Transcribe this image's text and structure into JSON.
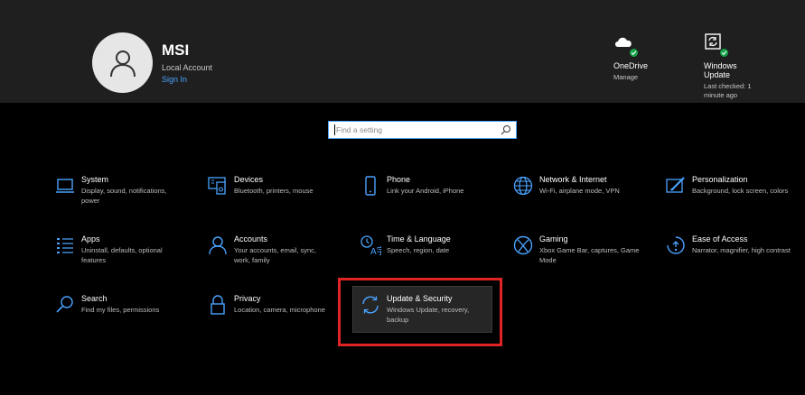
{
  "account": {
    "name": "MSI",
    "type": "Local Account",
    "signin": "Sign In"
  },
  "onedrive": {
    "title": "OneDrive",
    "sub": "Manage",
    "icon": "onedrive-cloud-icon"
  },
  "windows_update": {
    "title": "Windows Update",
    "sub": "Last checked: 1 minute ago",
    "icon": "refresh-icon"
  },
  "search": {
    "placeholder": "Find a setting",
    "icon": "search-icon"
  },
  "accent_color": "#4aa3ff",
  "tiles": [
    {
      "title": "System",
      "desc": "Display, sound, notifications, power",
      "icon": "laptop-icon"
    },
    {
      "title": "Devices",
      "desc": "Bluetooth, printers, mouse",
      "icon": "devices-icon"
    },
    {
      "title": "Phone",
      "desc": "Link your Android, iPhone",
      "icon": "phone-icon"
    },
    {
      "title": "Network & Internet",
      "desc": "Wi-Fi, airplane mode, VPN",
      "icon": "globe-icon"
    },
    {
      "title": "Personalization",
      "desc": "Background, lock screen, colors",
      "icon": "brush-icon"
    },
    {
      "title": "Apps",
      "desc": "Uninstall, defaults, optional features",
      "icon": "apps-list-icon"
    },
    {
      "title": "Accounts",
      "desc": "Your accounts, email, sync, work, family",
      "icon": "person-icon"
    },
    {
      "title": "Time & Language",
      "desc": "Speech, region, date",
      "icon": "time-language-icon"
    },
    {
      "title": "Gaming",
      "desc": "Xbox Game Bar, captures, Game Mode",
      "icon": "xbox-icon"
    },
    {
      "title": "Ease of Access",
      "desc": "Narrator, magnifier, high contrast",
      "icon": "ease-of-access-icon"
    },
    {
      "title": "Search",
      "desc": "Find my files, permissions",
      "icon": "search-icon"
    },
    {
      "title": "Privacy",
      "desc": "Location, camera, microphone",
      "icon": "lock-icon"
    },
    {
      "title": "Update & Security",
      "desc": "Windows Update, recovery, backup",
      "icon": "refresh-icon",
      "highlighted": true
    }
  ]
}
